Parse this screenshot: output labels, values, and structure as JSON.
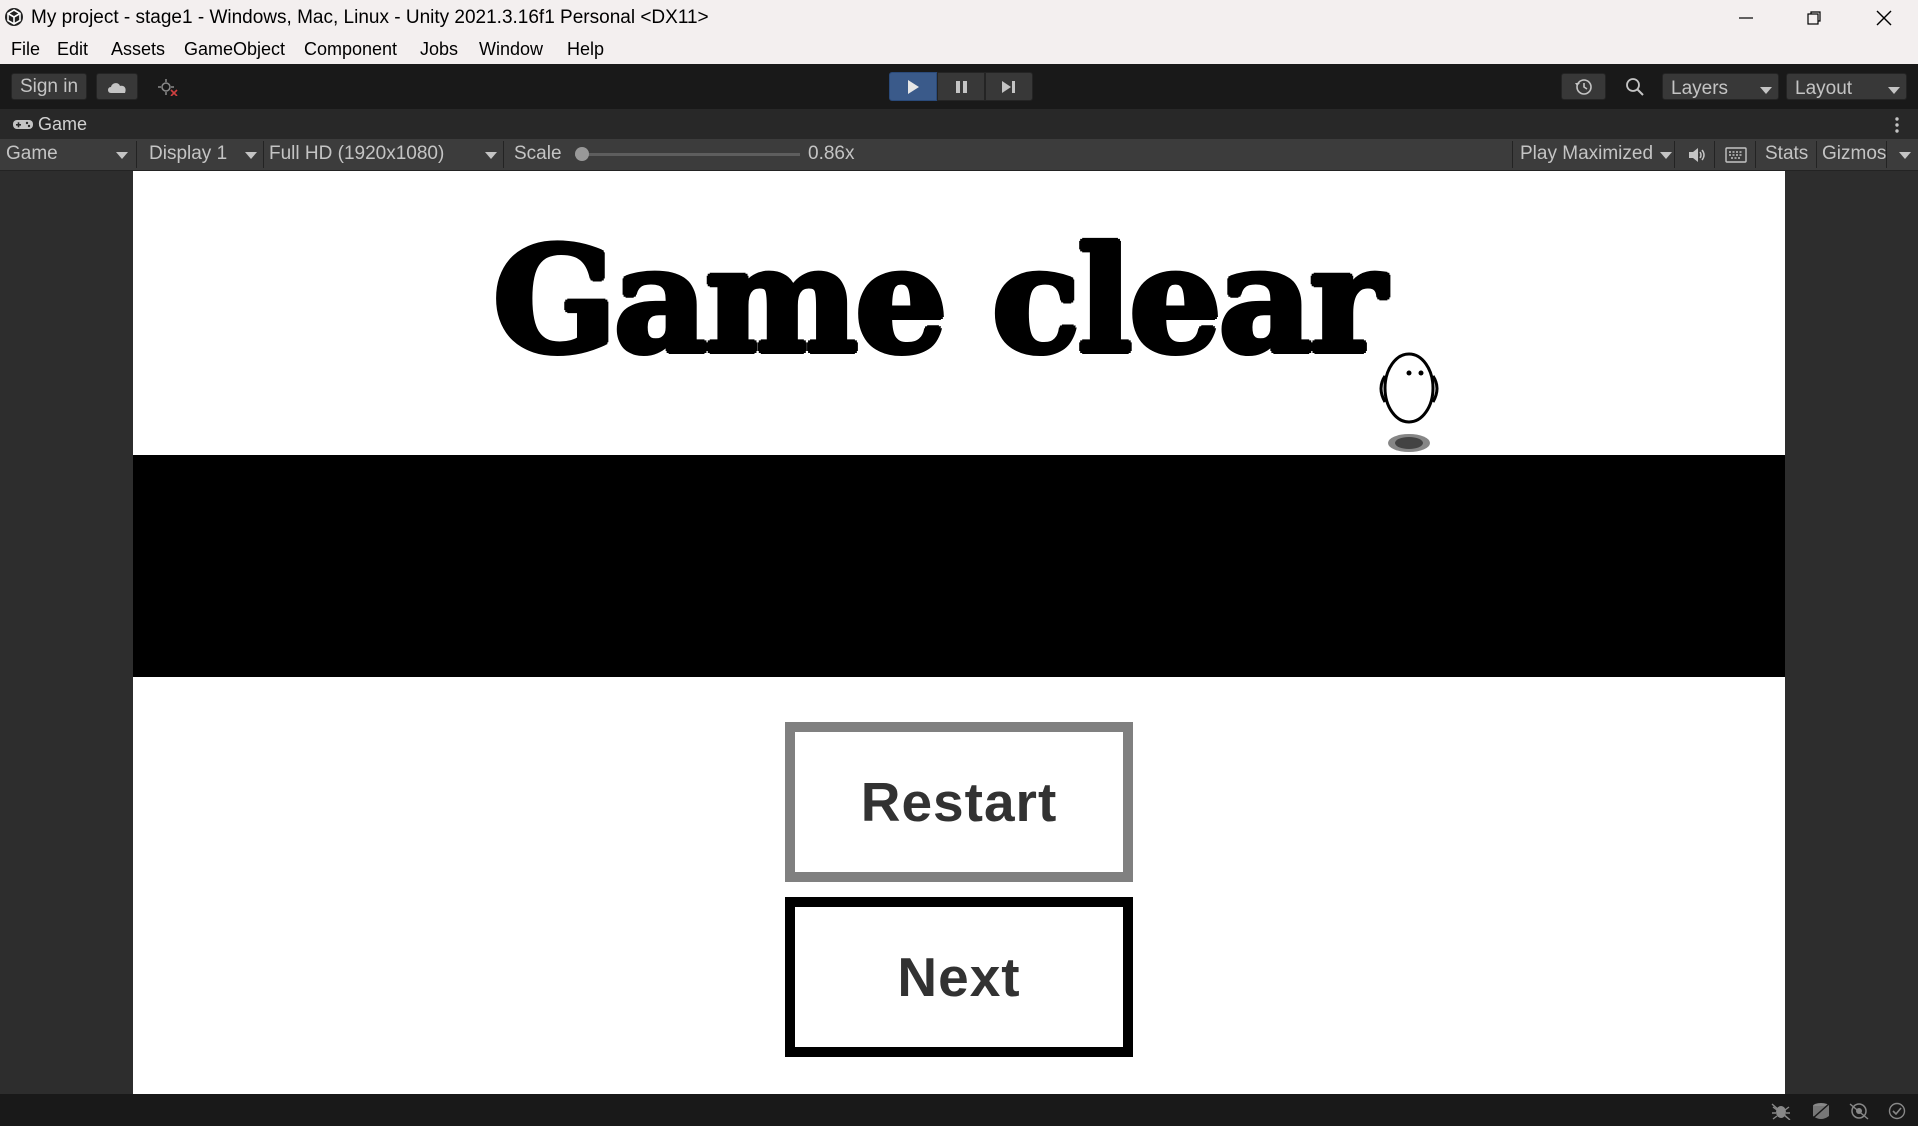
{
  "window": {
    "title": "My project - stage1 - Windows, Mac, Linux - Unity 2021.3.16f1 Personal <DX11>",
    "controls": [
      "minimize-icon",
      "restore-icon",
      "close-icon"
    ]
  },
  "menu": {
    "items": [
      "File",
      "Edit",
      "Assets",
      "GameObject",
      "Component",
      "Jobs",
      "Window",
      "Help"
    ]
  },
  "toolbar": {
    "sign_in": "Sign in",
    "cloud_icon": "cloud-icon",
    "collab_icon": "collab-icon",
    "play_icon": "play-icon",
    "pause_icon": "pause-icon",
    "step_icon": "step-icon",
    "play_active": true,
    "history_icon": "history-icon",
    "search_icon": "search-icon",
    "layers": "Layers",
    "layout": "Layout"
  },
  "tab": {
    "label": "Game",
    "icon": "gamepad-icon",
    "menu_icon": "kebab-icon"
  },
  "game_toolbar": {
    "view": "Game",
    "display": "Display 1",
    "resolution": "Full HD (1920x1080)",
    "scale_label": "Scale",
    "scale_value": "0.86x",
    "scale_slider_fraction": 0.0,
    "play_mode": "Play Maximized",
    "audio_icon": "speaker-icon",
    "keyboard_icon": "keyboard-icon",
    "stats": "Stats",
    "gizmos": "Gizmos"
  },
  "game": {
    "headline": "Game clear",
    "restart_button": "Restart",
    "next_button": "Next",
    "character_icon": "egg-character-icon"
  },
  "status_bar": {
    "icons": [
      "bug-icon",
      "cache-icon",
      "network-icon",
      "check-icon"
    ]
  },
  "colors": {
    "editor_bg": "#191919",
    "panel_bg": "#282828",
    "play_active": "#3a5a8a",
    "game_bg": "#ffffff",
    "floor": "#000000",
    "restart_border": "#808080",
    "next_border": "#000000"
  }
}
